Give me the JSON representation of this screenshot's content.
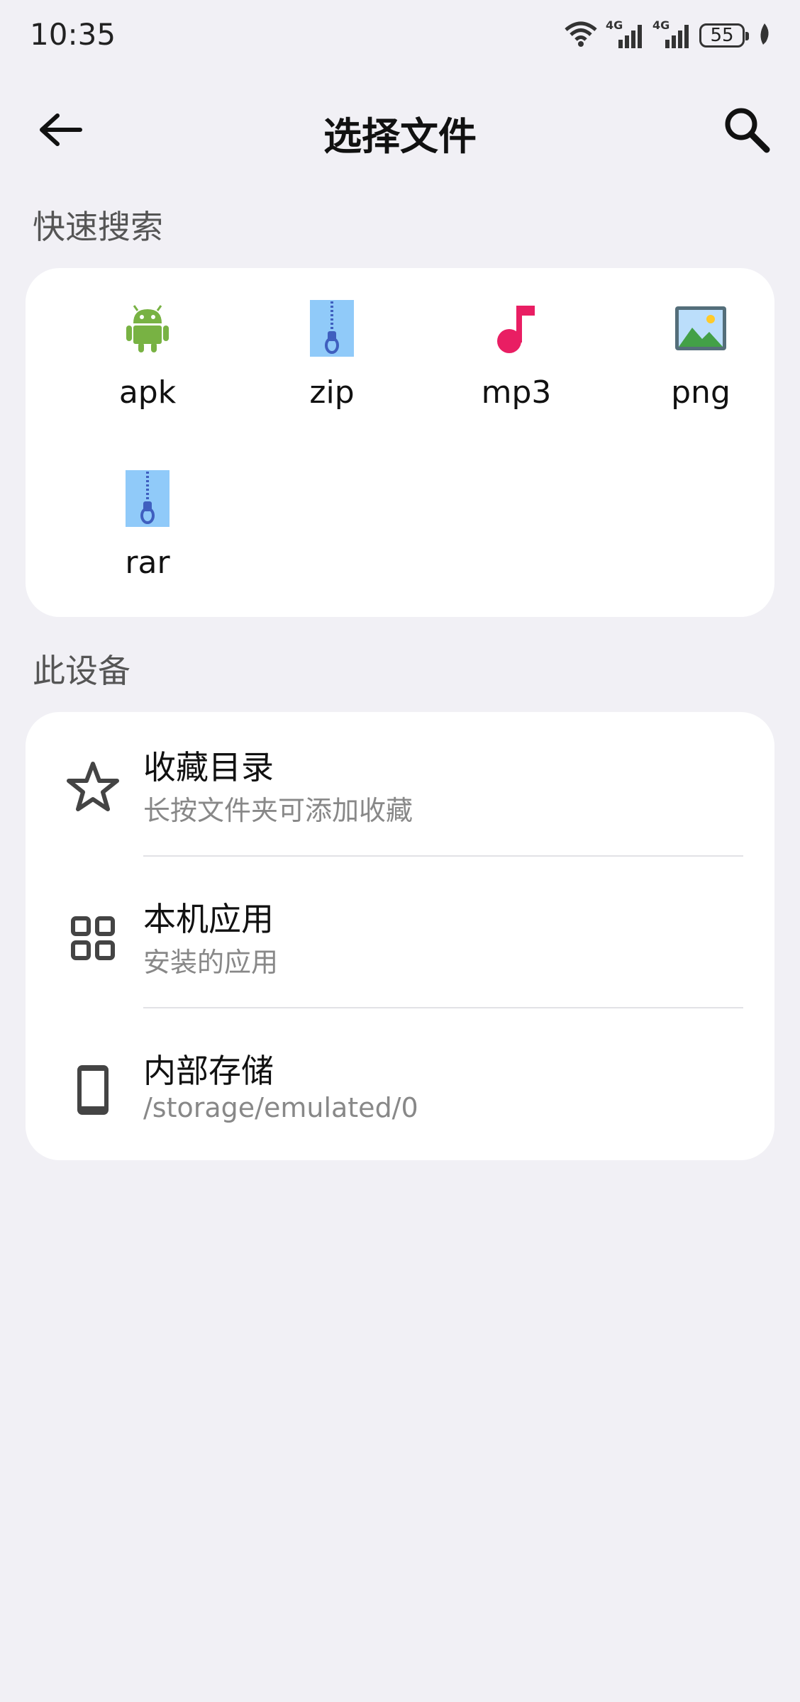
{
  "status": {
    "time": "10:35",
    "battery": "55",
    "net1": "4G",
    "net2": "4G"
  },
  "header": {
    "title": "选择文件"
  },
  "quick_search": {
    "label": "快速搜索",
    "items": [
      {
        "label": "apk",
        "icon": "android-icon"
      },
      {
        "label": "zip",
        "icon": "zip-archive-icon"
      },
      {
        "label": "mp3",
        "icon": "music-note-icon"
      },
      {
        "label": "png",
        "icon": "image-icon"
      },
      {
        "label": "rar",
        "icon": "rar-archive-icon"
      }
    ]
  },
  "device": {
    "label": "此设备",
    "items": [
      {
        "title": "收藏目录",
        "subtitle": "长按文件夹可添加收藏",
        "icon": "star-icon"
      },
      {
        "title": "本机应用",
        "subtitle": "安装的应用",
        "icon": "apps-grid-icon"
      },
      {
        "title": "内部存储",
        "subtitle": "/storage/emulated/0",
        "icon": "phone-icon"
      }
    ]
  },
  "colors": {
    "background": "#f1f0f5",
    "card": "#ffffff",
    "android": "#78b243",
    "zip": "#90caf9",
    "music": "#e91e63"
  }
}
